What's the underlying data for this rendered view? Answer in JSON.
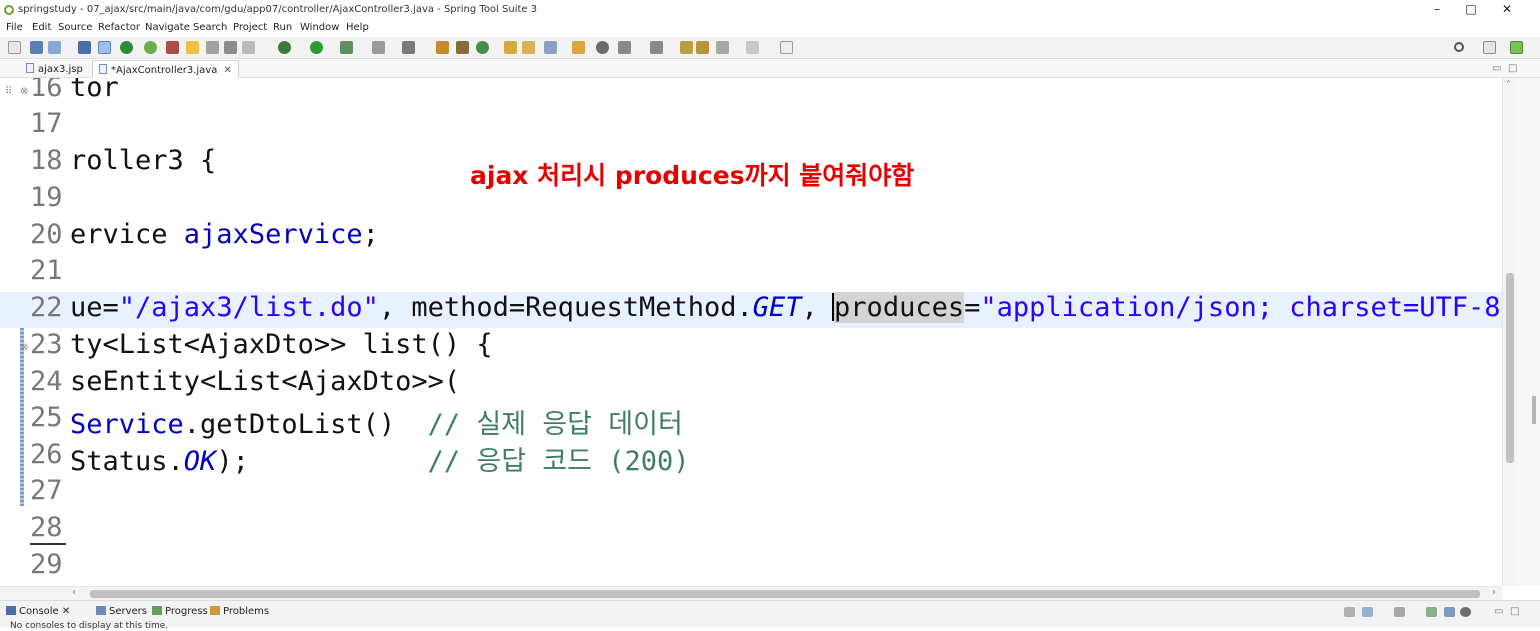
{
  "window": {
    "title": "springstudy - 07_ajax/src/main/java/com/gdu/app07/controller/AjaxController3.java - Spring Tool Suite 3",
    "minimize": "–",
    "maximize": "□",
    "close": "✕"
  },
  "menu": [
    "File",
    "Edit",
    "Source",
    "Refactor",
    "Navigate",
    "Search",
    "Project",
    "Run",
    "Window",
    "Help"
  ],
  "tabs": [
    {
      "label": "ajax3.jsp",
      "active": false
    },
    {
      "label": "*AjaxController3.java",
      "active": true,
      "close": "✕"
    }
  ],
  "editor": {
    "annotation": "ajax 처리시 produces까지 붙여줘야함",
    "lines": [
      {
        "num": "16",
        "a": "tor"
      },
      {
        "num": "17",
        "a": ""
      },
      {
        "num": "18",
        "a": "roller3 {"
      },
      {
        "num": "19",
        "a": ""
      },
      {
        "num": "20",
        "a": "ervice ",
        "b": "ajaxService",
        "c": ";"
      },
      {
        "num": "21",
        "a": ""
      },
      {
        "num": "22",
        "a": "ue=",
        "b": "\"/ajax3/list.do\"",
        "c": ", method=RequestMethod.",
        "d": "GET",
        "e": ", ",
        "f": "produces",
        "g": "=",
        "h": "\"application/json; charset=UTF-8\"",
        "i": ")"
      },
      {
        "num": "23",
        "a": "ty<List<AjaxDto>> list() {"
      },
      {
        "num": "24",
        "a": "seEntity<List<AjaxDto>>("
      },
      {
        "num": "25",
        "a": "Service",
        "b": ".getDtoList()  ",
        "c": "// 실제 응답 데이터"
      },
      {
        "num": "26",
        "a": "Status.",
        "b": "OK",
        "c": ");           ",
        "d": "// 응답 코드 (200)"
      },
      {
        "num": "27",
        "a": ""
      },
      {
        "num": "28",
        "a": ""
      },
      {
        "num": "29",
        "a": ""
      }
    ]
  },
  "bottom_tabs": [
    {
      "label": "Console",
      "close": "✕"
    },
    {
      "label": "Servers"
    },
    {
      "label": "Progress"
    },
    {
      "label": "Problems"
    }
  ],
  "status_message": "No consoles to display at this time."
}
